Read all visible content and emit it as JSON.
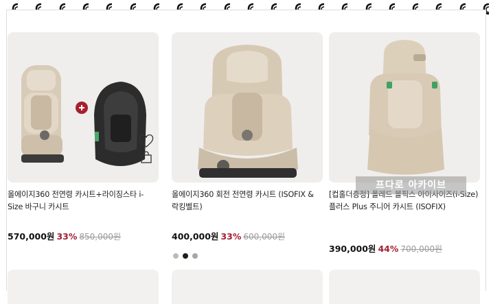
{
  "products": [
    {
      "title": "올에이지360 전연령 카시트+라이징스타 i-Size 바구니 카시트",
      "price": "570,000원",
      "discount": "33%",
      "original_price": "850,000원",
      "image": "car-seat-bundle-image"
    },
    {
      "title": "올에이지360 회전 전연령 카시트 (ISOFIX & 락킹벨트)",
      "price": "400,000원",
      "discount": "33%",
      "original_price": "600,000원",
      "image": "car-seat-image",
      "color_swatches": [
        "#c2bba9",
        "#1e1e1e",
        "#a6a6a6"
      ]
    },
    {
      "title": "[컵홀더증정] 폴레드 볼픽스 아이사이즈(i-Size) 플러스 Plus 주니어 카시트 (ISOFIX)",
      "price": "390,000원",
      "discount": "44%",
      "original_price": "700,000원",
      "image": "booster-seat-image"
    }
  ],
  "watermark": "프다로 아카이브",
  "colors": {
    "discount": "#a32032",
    "thumb_background": "#efeeec",
    "plus_badge": "#a8202e"
  }
}
